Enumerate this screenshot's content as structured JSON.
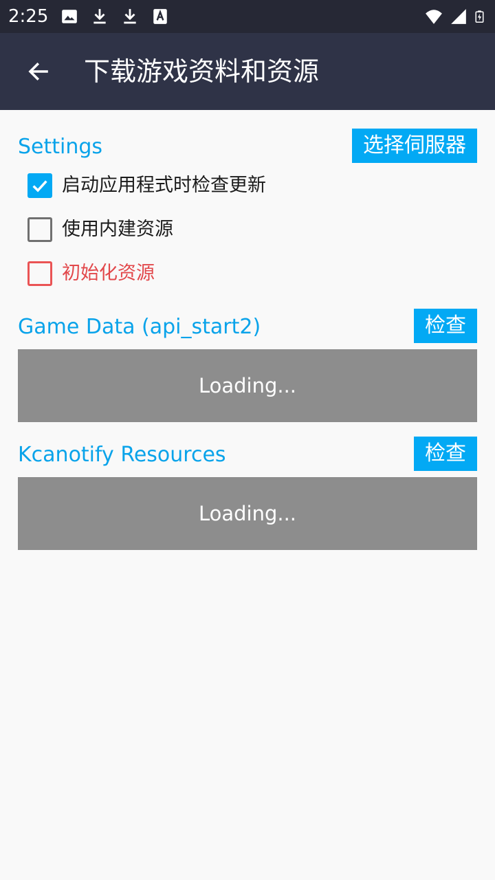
{
  "status_bar": {
    "time": "2:25",
    "left_icons": [
      "image-icon",
      "download-icon",
      "download-icon",
      "font-icon"
    ],
    "right_icons": [
      "wifi-icon",
      "signal-icon",
      "battery-charging-icon"
    ]
  },
  "app_bar": {
    "title": "下载游戏资料和资源",
    "back_icon": "arrow-left-icon"
  },
  "settings": {
    "title": "Settings",
    "server_button_label": "选择伺服器",
    "options": [
      {
        "label": "启动应用程式时检查更新",
        "checked": true
      },
      {
        "label": "使用内建资源",
        "checked": false
      },
      {
        "label": "初始化资源",
        "checked": false,
        "color": "#e2484b"
      }
    ]
  },
  "game_data": {
    "title": "Game Data (api_start2)",
    "check_button_label": "检查",
    "status": "Loading..."
  },
  "resources": {
    "title": "Kcanotify Resources",
    "check_button_label": "检查",
    "status": "Loading..."
  },
  "colors": {
    "status_bar": "#262835",
    "app_bar": "#2f3347",
    "accent": "#03a9f4",
    "danger": "#e2484b",
    "loading_panel": "#8d8d8d",
    "background": "#f9f9f9"
  }
}
